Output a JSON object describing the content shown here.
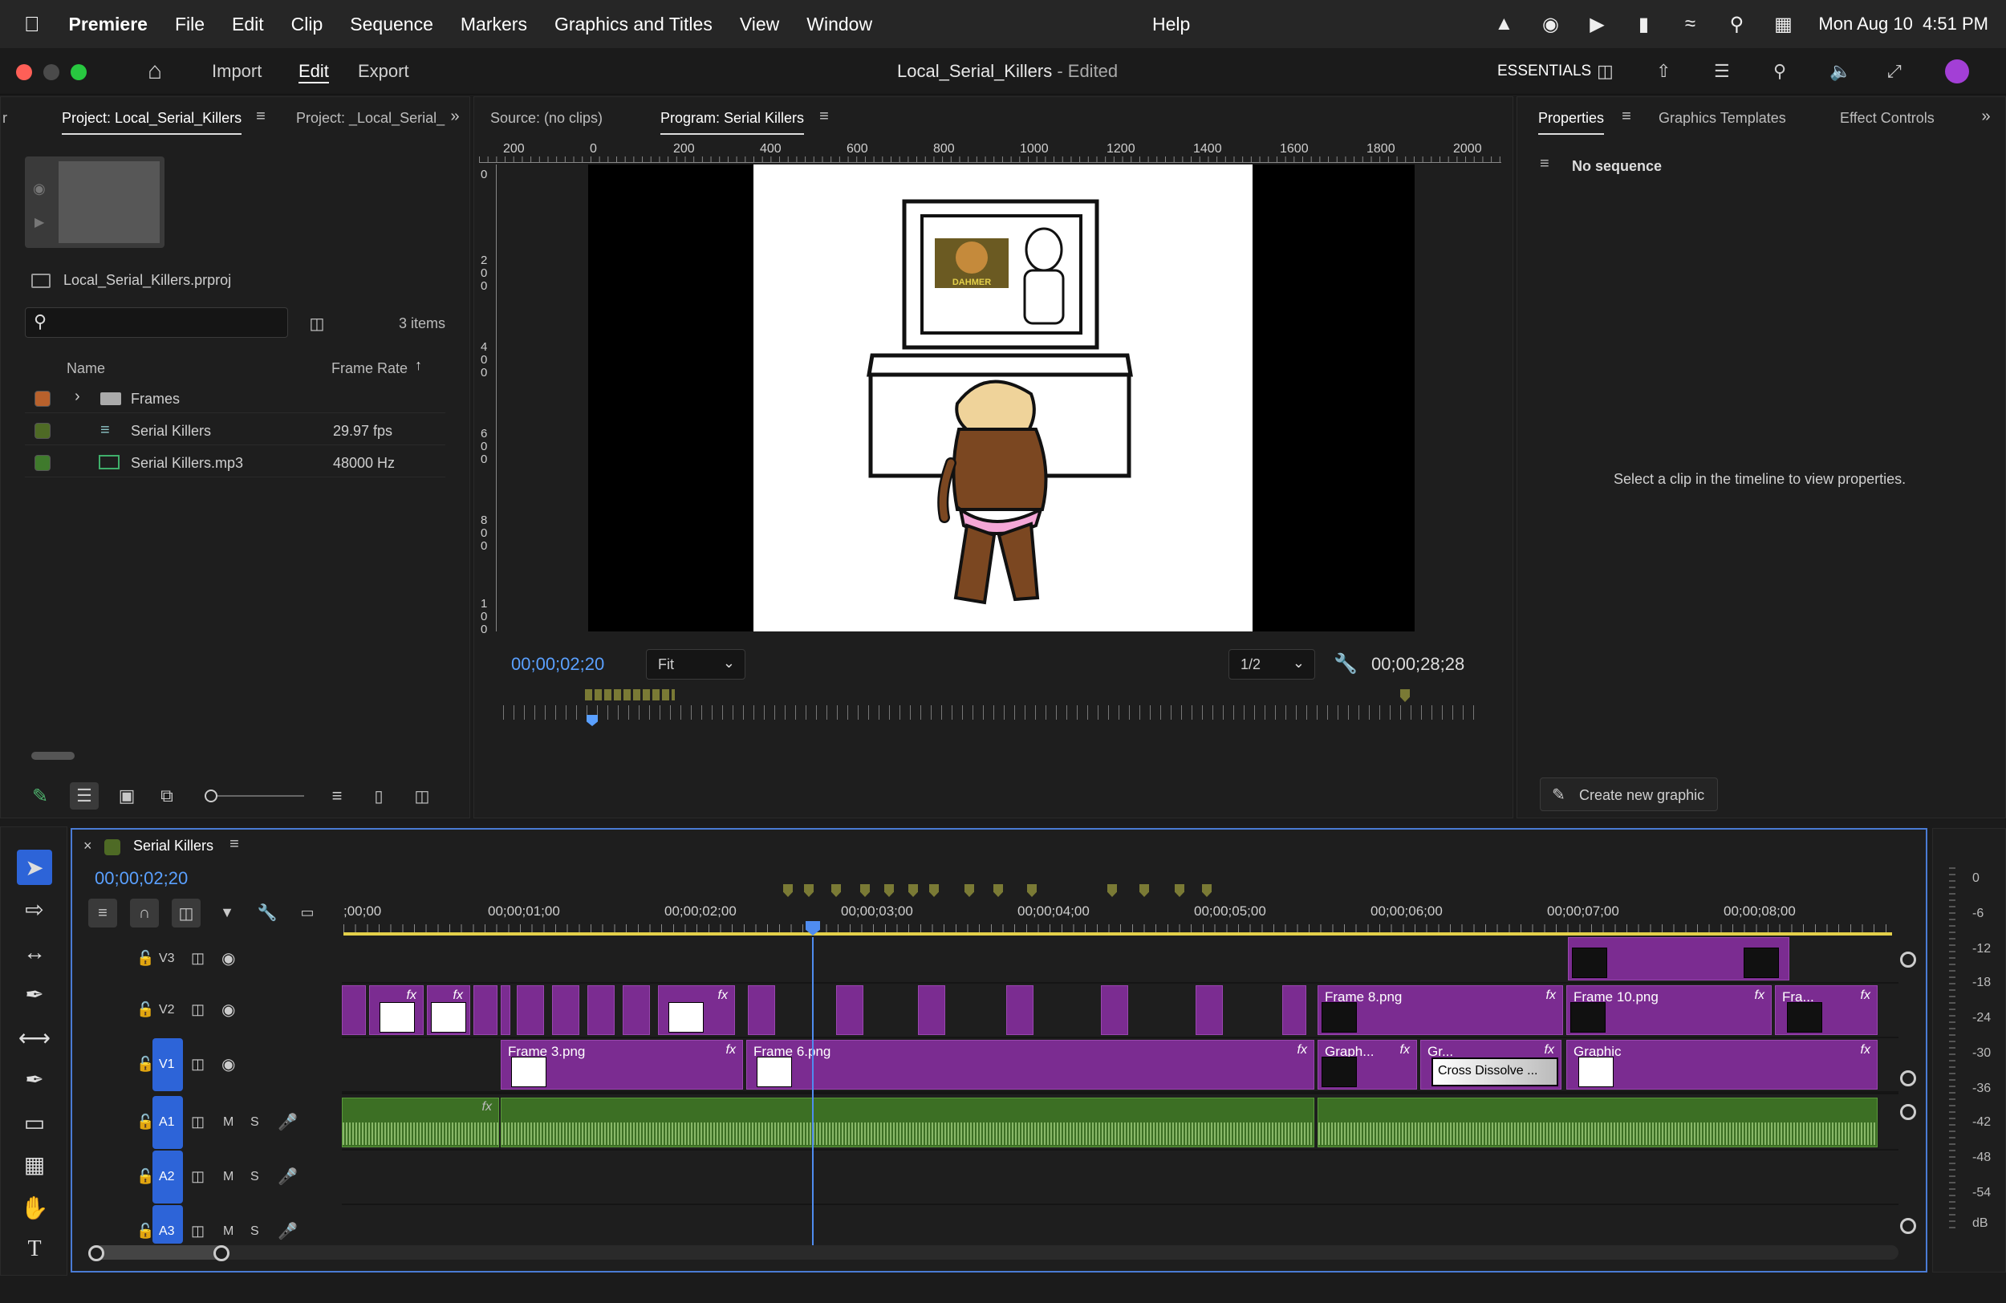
{
  "menubar": {
    "app": "Premiere",
    "items": [
      "File",
      "Edit",
      "Clip",
      "Sequence",
      "Markers",
      "Graphics and Titles",
      "View",
      "Window",
      "Help"
    ],
    "datetime": "Mon Aug 10  4:51 PM"
  },
  "header": {
    "nav": [
      "Import",
      "Edit",
      "Export"
    ],
    "title": "Local_Serial_Killers",
    "title_suffix": " - Edited",
    "workspace": "ESSENTIALS"
  },
  "project": {
    "tab1": "Project: Local_Serial_Killers",
    "tab2": "Project: _Local_Serial_",
    "file": "Local_Serial_Killers.prproj",
    "count": "3 items",
    "col_name": "Name",
    "col_rate": "Frame Rate",
    "rows": [
      {
        "name": "Frames",
        "rate": "",
        "color": "#b8612c"
      },
      {
        "name": "Serial Killers",
        "rate": "29.97 fps",
        "color": "#4e6a25"
      },
      {
        "name": "Serial Killers.mp3",
        "rate": "48000 Hz",
        "color": "#3f7a2c"
      }
    ]
  },
  "monitor": {
    "source_tab": "Source: (no clips)",
    "program_tab": "Program: Serial Killers",
    "timecode": "00;00;02;20",
    "zoom": "Fit",
    "quality": "1/2",
    "duration": "00;00;28;28",
    "ruler_h": [
      "200",
      "0",
      "200",
      "400",
      "600",
      "800",
      "1000",
      "1200",
      "1400",
      "1600",
      "1800",
      "2000"
    ],
    "ruler_v": [
      "0",
      "200",
      "400",
      "600",
      "800",
      "100"
    ],
    "poster_text": "DAHMER"
  },
  "properties": {
    "tabs": [
      "Properties",
      "Graphics Templates",
      "Effect Controls"
    ],
    "no_seq": "No sequence",
    "hint": "Select a clip in the timeline to view properties.",
    "create": "Create new graphic"
  },
  "timeline": {
    "tab": "Serial Killers",
    "timecode": "00;00;02;20",
    "ruler": [
      ";00;00",
      "00;00;01;00",
      "00;00;02;00",
      "00;00;03;00",
      "00;00;04;00",
      "00;00;05;00",
      "00;00;06;00",
      "00;00;07;00",
      "00;00;08;00"
    ],
    "tracks": [
      "V3",
      "V2",
      "V1",
      "A1",
      "A2",
      "A3"
    ],
    "track_letters": {
      "m": "M",
      "s": "S"
    },
    "clips": {
      "v1_a": "Frame 3.png",
      "v1_b": "Frame 6.png",
      "v1_c": "Graph...",
      "v1_d": "Gr...",
      "v1_e": "Graphic",
      "v1_trans": "Cross Dissolve ...",
      "v2_a": "Frame 8.png",
      "v2_b": "Frame 10.png",
      "v2_c": "Fra...",
      "fx": "fx"
    }
  },
  "meter": {
    "labels": [
      "0",
      "-6",
      "-12",
      "-18",
      "-24",
      "-30",
      "-36",
      "-42",
      "-48",
      "-54",
      "dB"
    ]
  }
}
